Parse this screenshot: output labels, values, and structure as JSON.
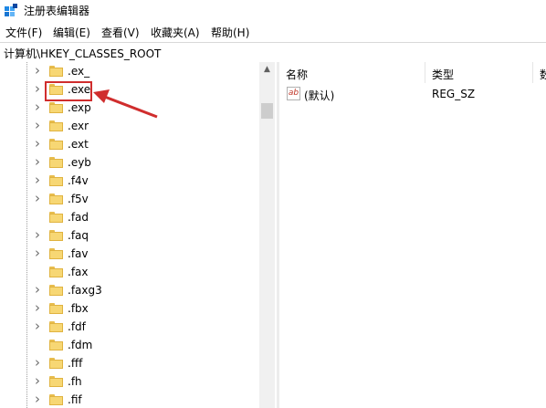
{
  "window": {
    "title": "注册表编辑器"
  },
  "menu": [
    {
      "label": "文件(F)"
    },
    {
      "label": "编辑(E)"
    },
    {
      "label": "查看(V)"
    },
    {
      "label": "收藏夹(A)"
    },
    {
      "label": "帮助(H)"
    }
  ],
  "address": {
    "path": "计算机\\HKEY_CLASSES_ROOT"
  },
  "tree": {
    "items": [
      {
        "label": ".ex_",
        "expandable": true
      },
      {
        "label": ".exe",
        "expandable": true,
        "highlighted": true
      },
      {
        "label": ".exp",
        "expandable": true
      },
      {
        "label": ".exr",
        "expandable": true
      },
      {
        "label": ".ext",
        "expandable": true
      },
      {
        "label": ".eyb",
        "expandable": true
      },
      {
        "label": ".f4v",
        "expandable": true
      },
      {
        "label": ".f5v",
        "expandable": true
      },
      {
        "label": ".fad",
        "expandable": false
      },
      {
        "label": ".faq",
        "expandable": true
      },
      {
        "label": ".fav",
        "expandable": true
      },
      {
        "label": ".fax",
        "expandable": false
      },
      {
        "label": ".faxg3",
        "expandable": true
      },
      {
        "label": ".fbx",
        "expandable": true
      },
      {
        "label": ".fdf",
        "expandable": true
      },
      {
        "label": ".fdm",
        "expandable": false
      },
      {
        "label": ".fff",
        "expandable": true
      },
      {
        "label": ".fh",
        "expandable": true
      },
      {
        "label": ".fif",
        "expandable": true
      }
    ]
  },
  "list": {
    "columns": [
      {
        "label": "名称"
      },
      {
        "label": "类型"
      },
      {
        "label": "数"
      }
    ],
    "rows": [
      {
        "icon": "string-value-icon",
        "icon_text": "ab",
        "name": "(默认)",
        "type": "REG_SZ"
      }
    ]
  },
  "annotation": {
    "color": "#d02d2d",
    "target": ".exe"
  }
}
